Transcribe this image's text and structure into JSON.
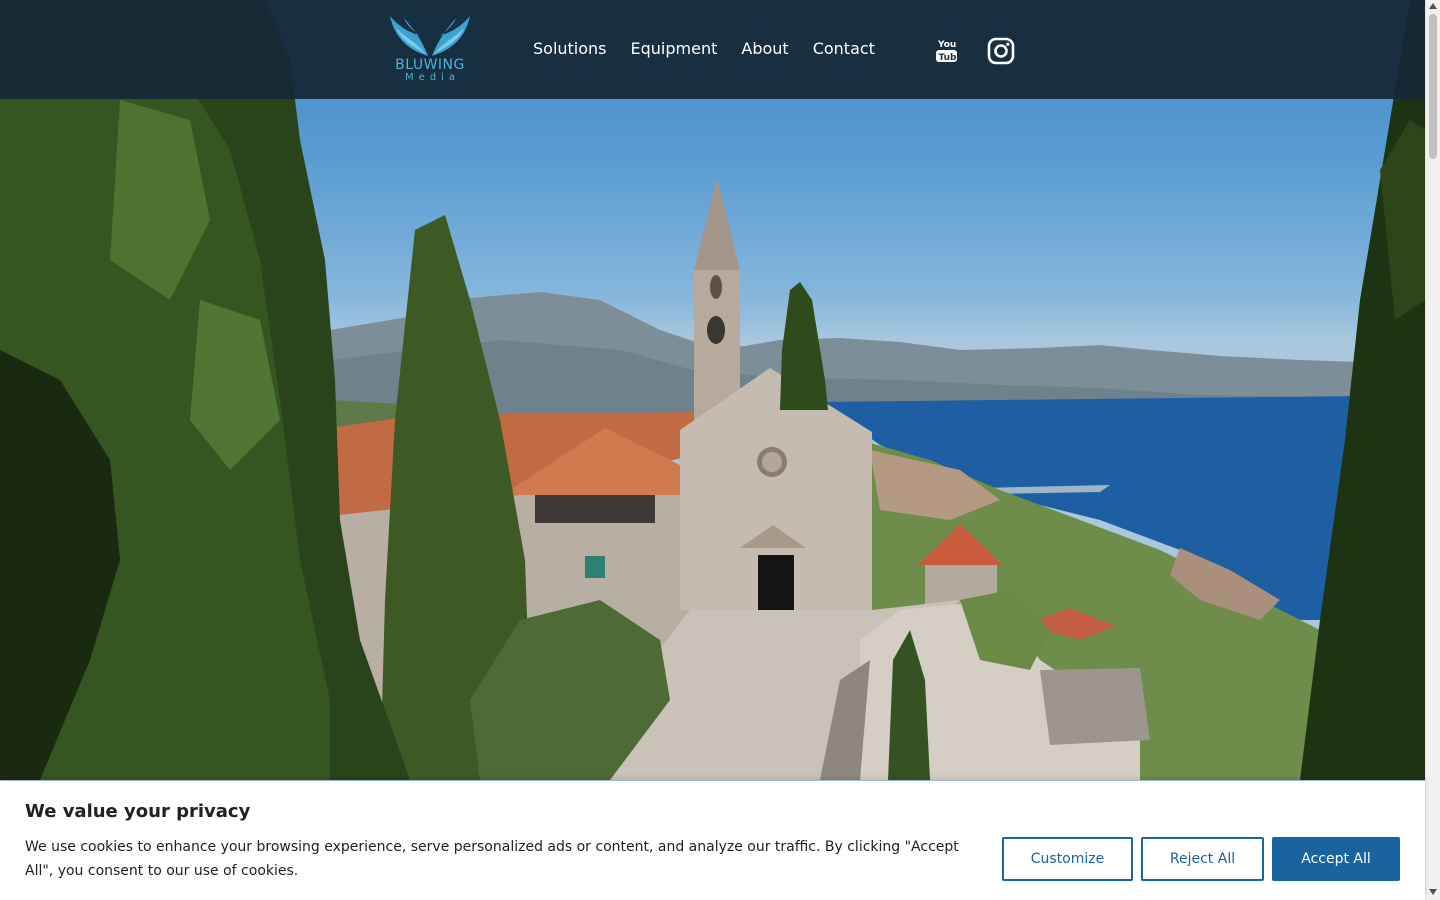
{
  "brand": {
    "logo_name": "BLUWING",
    "logo_sub": "Media"
  },
  "nav": {
    "items": [
      {
        "label": "Solutions"
      },
      {
        "label": "Equipment"
      },
      {
        "label": "About"
      },
      {
        "label": "Contact"
      }
    ]
  },
  "social": {
    "youtube_icon": "youtube-icon",
    "instagram_icon": "instagram-icon"
  },
  "hero": {
    "image": "aerial-church-coastline-scene"
  },
  "cookie_banner": {
    "title": "We value your privacy",
    "text": "We use cookies to enhance your browsing experience, serve personalized ads or content, and analyze our traffic. By clicking \"Accept All\", you consent to our use of cookies.",
    "customize_label": "Customize",
    "reject_label": "Reject All",
    "accept_label": "Accept All"
  },
  "colors": {
    "header_bg": "#142837",
    "logo": "#4fb0d8",
    "accent": "#1863a0"
  }
}
